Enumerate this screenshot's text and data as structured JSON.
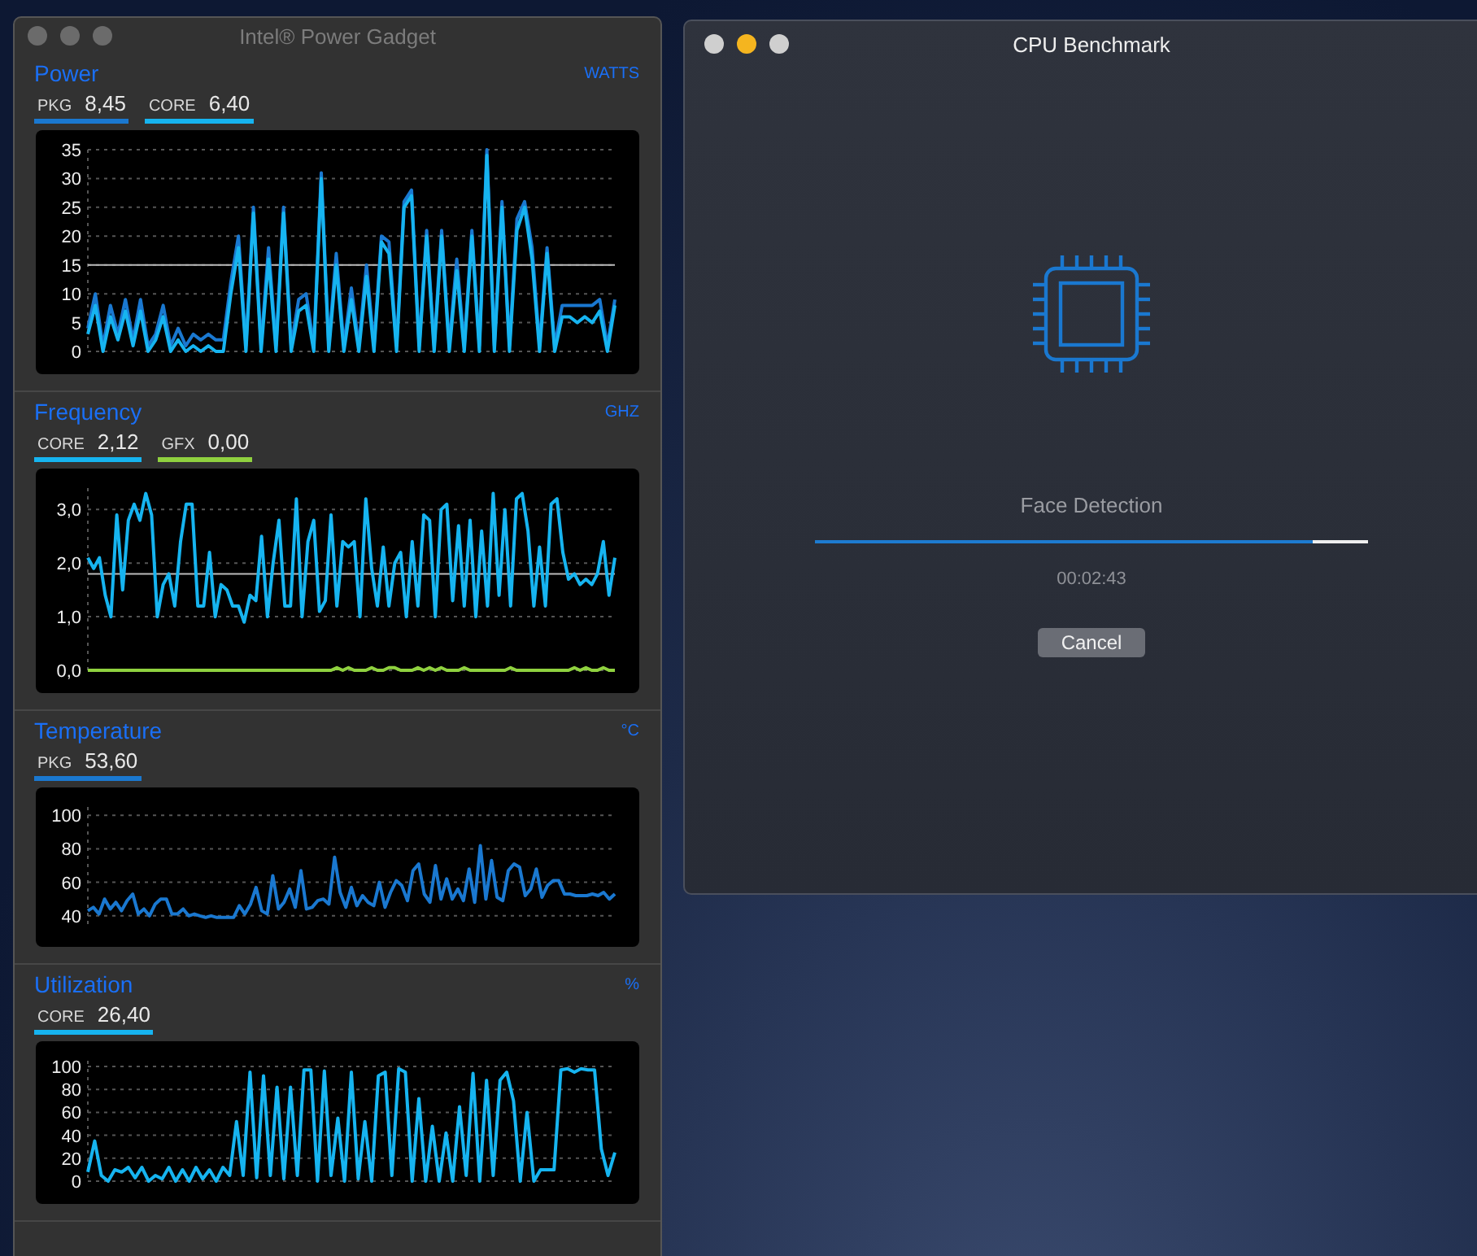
{
  "gadget_window": {
    "title": "Intel® Power Gadget",
    "lights": [
      {
        "color": "#6b6b6b"
      },
      {
        "color": "#6b6b6b"
      },
      {
        "color": "#6b6b6b"
      }
    ],
    "sections": [
      {
        "title": "Power",
        "unit": "WATTS",
        "readouts": [
          {
            "value": "8,45"
          },
          {
            "value": "6,40"
          }
        ],
        "chart_data": {
          "type": "line",
          "grid": true,
          "ylim": [
            0,
            35
          ],
          "yticks": [
            0,
            5,
            10,
            15,
            20,
            25,
            30,
            35
          ],
          "ref_lines": [
            {
              "axis": "y",
              "value": 15
            }
          ],
          "series": [
            {
              "name": "PKG",
              "color": "#1a78d0",
              "values": [
                4,
                10,
                1,
                8,
                3,
                9,
                2,
                9,
                1,
                3,
                8,
                1,
                4,
                1,
                3,
                2,
                3,
                2,
                2,
                12,
                20,
                1,
                25,
                1,
                18,
                1,
                25,
                1,
                9,
                10,
                1,
                31,
                1,
                17,
                1,
                11,
                1,
                15,
                1,
                20,
                19,
                1,
                26,
                28,
                1,
                21,
                1,
                21,
                1,
                16,
                1,
                21,
                1,
                35,
                1,
                26,
                1,
                23,
                26,
                18,
                1,
                18,
                1,
                8,
                8,
                8,
                8,
                8,
                9,
                1,
                9
              ]
            },
            {
              "name": "CORE",
              "color": "#16b4f0",
              "values": [
                3,
                8,
                0,
                6,
                2,
                7,
                1,
                7,
                0,
                2,
                6,
                0,
                2,
                0,
                1,
                0,
                1,
                0,
                0,
                10,
                18,
                0,
                24,
                0,
                16,
                0,
                24,
                0,
                7,
                8,
                0,
                30,
                0,
                15,
                0,
                9,
                0,
                13,
                0,
                19,
                17,
                0,
                25,
                27,
                0,
                20,
                0,
                20,
                0,
                14,
                0,
                20,
                0,
                34,
                0,
                25,
                0,
                21,
                25,
                16,
                0,
                17,
                0,
                6,
                6,
                5,
                6,
                5,
                7,
                0,
                8
              ]
            }
          ]
        }
      },
      {
        "title": "Frequency",
        "unit": "GHZ",
        "readouts": [
          {
            "value": "2,12"
          },
          {
            "value": "0,00"
          }
        ],
        "chart_data": {
          "type": "line",
          "grid": true,
          "ylim": [
            0,
            3.4
          ],
          "yticks": [
            {
              "value": 0,
              "label": "0,0"
            },
            {
              "value": 1,
              "label": "1,0"
            },
            {
              "value": 2,
              "label": "2,0"
            },
            {
              "value": 3,
              "label": "3,0"
            }
          ],
          "ref_lines": [
            {
              "axis": "y",
              "value": 1.8
            }
          ],
          "series": [
            {
              "name": "CORE",
              "color": "#16b4f0",
              "values": [
                2.1,
                1.9,
                2.1,
                1.4,
                1.0,
                2.9,
                1.5,
                2.8,
                3.1,
                2.8,
                3.3,
                2.9,
                1.0,
                1.6,
                1.8,
                1.2,
                2.4,
                3.1,
                3.1,
                1.2,
                1.2,
                2.2,
                1.0,
                1.6,
                1.5,
                1.2,
                1.2,
                0.9,
                1.4,
                1.3,
                2.5,
                1.0,
                2.0,
                2.8,
                1.2,
                1.2,
                3.2,
                1.0,
                2.4,
                2.8,
                1.1,
                1.3,
                2.9,
                1.2,
                2.4,
                2.3,
                2.4,
                1.0,
                3.2,
                1.9,
                1.2,
                2.3,
                1.2,
                2.0,
                2.2,
                1.0,
                2.4,
                1.2,
                2.9,
                2.8,
                1.0,
                3.0,
                3.1,
                1.3,
                2.7,
                1.2,
                2.8,
                1.0,
                2.6,
                1.2,
                3.3,
                1.4,
                3.0,
                1.2,
                3.2,
                3.3,
                2.6,
                1.2,
                2.3,
                1.2,
                3.1,
                3.2,
                2.2,
                1.7,
                1.8,
                1.6,
                1.7,
                1.6,
                1.8,
                2.4,
                1.4,
                2.1
              ]
            },
            {
              "name": "GFX",
              "color": "#8fd13f",
              "values": [
                0,
                0,
                0,
                0,
                0,
                0,
                0,
                0,
                0,
                0,
                0,
                0,
                0,
                0,
                0,
                0,
                0,
                0,
                0,
                0,
                0,
                0,
                0,
                0,
                0,
                0,
                0,
                0,
                0,
                0,
                0,
                0,
                0,
                0,
                0,
                0,
                0,
                0,
                0,
                0,
                0,
                0,
                0,
                0.05,
                0,
                0.05,
                0,
                0,
                0,
                0.05,
                0,
                0,
                0.05,
                0.05,
                0,
                0,
                0,
                0.05,
                0,
                0.05,
                0,
                0.05,
                0,
                0,
                0,
                0.05,
                0,
                0,
                0,
                0,
                0,
                0,
                0,
                0.05,
                0,
                0,
                0,
                0,
                0,
                0,
                0,
                0,
                0,
                0,
                0.05,
                0,
                0.05,
                0,
                0,
                0.05,
                0,
                0
              ]
            }
          ]
        }
      },
      {
        "title": "Temperature",
        "unit": "°C",
        "readouts": [
          {
            "value": "53,60"
          }
        ],
        "chart_data": {
          "type": "line",
          "grid": true,
          "ylim": [
            35,
            105
          ],
          "yticks": [
            40,
            60,
            80,
            100
          ],
          "series": [
            {
              "name": "PKG",
              "color": "#1a78d0",
              "values": [
                43,
                45,
                41,
                50,
                44,
                48,
                43,
                49,
                53,
                41,
                44,
                40,
                47,
                50,
                50,
                41,
                41,
                44,
                40,
                41,
                40,
                39,
                40,
                39,
                39,
                39,
                39,
                46,
                41,
                47,
                57,
                43,
                41,
                64,
                44,
                48,
                56,
                45,
                67,
                44,
                45,
                49,
                50,
                47,
                75,
                54,
                45,
                57,
                46,
                52,
                48,
                46,
                60,
                45,
                54,
                61,
                58,
                49,
                67,
                71,
                53,
                48,
                70,
                50,
                62,
                50,
                56,
                49,
                68,
                48,
                82,
                50,
                73,
                51,
                49,
                67,
                71,
                69,
                52,
                56,
                68,
                51,
                58,
                61,
                61,
                53,
                53,
                52,
                52,
                52,
                53,
                52,
                54,
                50,
                53
              ]
            }
          ]
        }
      },
      {
        "title": "Utilization",
        "unit": "%",
        "readouts": [
          {
            "value": "26,40"
          }
        ],
        "chart_data": {
          "type": "line",
          "grid": true,
          "ylim": [
            0,
            105
          ],
          "yticks": [
            0,
            20,
            40,
            60,
            80,
            100
          ],
          "series": [
            {
              "name": "CORE",
              "color": "#16b4f0",
              "values": [
                8,
                35,
                5,
                0,
                10,
                8,
                12,
                3,
                12,
                0,
                5,
                2,
                12,
                0,
                10,
                0,
                12,
                2,
                10,
                0,
                12,
                5,
                52,
                5,
                95,
                3,
                92,
                5,
                82,
                2,
                82,
                5,
                97,
                97,
                0,
                96,
                5,
                55,
                0,
                95,
                2,
                52,
                0,
                92,
                95,
                5,
                98,
                95,
                0,
                72,
                0,
                48,
                0,
                42,
                0,
                65,
                5,
                94,
                0,
                88,
                5,
                88,
                95,
                70,
                0,
                60,
                0,
                10,
                10,
                10,
                97,
                98,
                95,
                98,
                97,
                97,
                28,
                5,
                25
              ]
            }
          ]
        }
      }
    ]
  },
  "benchmark_window": {
    "title": "CPU Benchmark",
    "lights": [
      {
        "color": "#cfcfcf"
      },
      {
        "color": "#f5b51f"
      },
      {
        "color": "#cfcfcf"
      }
    ],
    "task": "Face Detection",
    "progress": {
      "level": 0.9
    },
    "elapsed": "00:02:43",
    "cancel_button": "Cancel"
  }
}
